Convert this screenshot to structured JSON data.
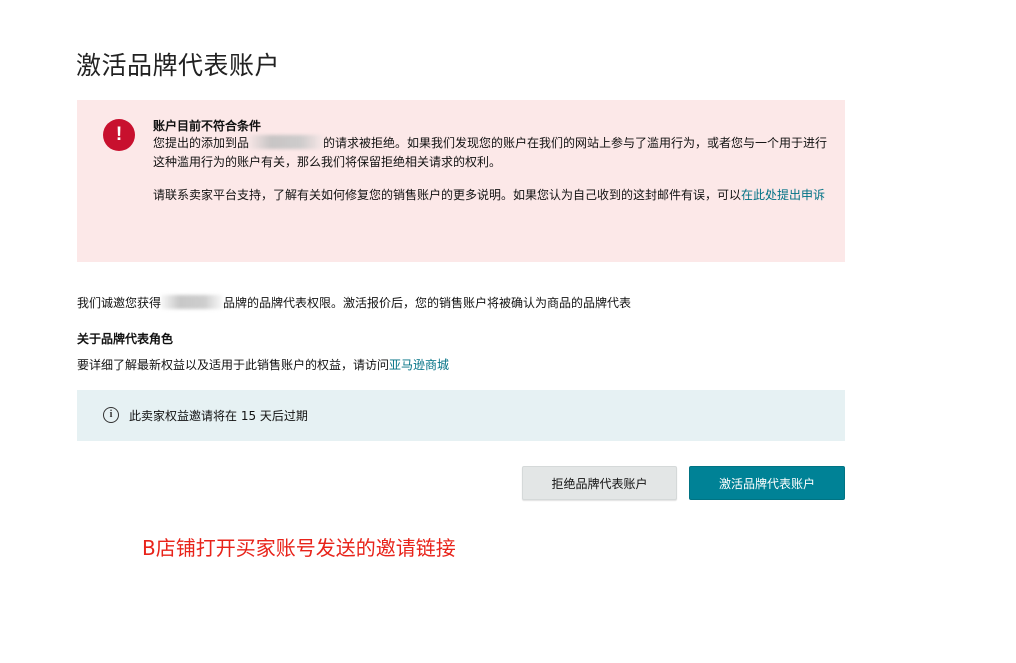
{
  "page": {
    "title": "激活品牌代表账户"
  },
  "error_alert": {
    "icon": "exclamation-icon",
    "title": "账户目前不符合条件",
    "para1_before": "您提出的添加到品",
    "para1_after": "的请求被拒绝。如果我们发现您的账户在我们的网站上参与了滥用行为，或者您与一个用于进行这种滥用行为的账户有关，那么我们将保留拒绝相关请求的权利。",
    "para2_text": "请联系卖家平台支持，了解有关如何修复您的销售账户的更多说明。如果您认为自己收到的这封邮件有误，可以",
    "para2_link": "在此处提出申诉",
    "color": "#fce8e8",
    "icon_color": "#c8102e"
  },
  "invite": {
    "before": "我们诚邀您获得",
    "after": "品牌的品牌代表权限。激活报价后，您的销售账户将被确认为商品的品牌代表"
  },
  "role_section": {
    "heading": "关于品牌代表角色",
    "text": "要详细了解最新权益以及适用于此销售账户的权益，请访问",
    "link": "亚马逊商城"
  },
  "info_alert": {
    "icon": "info-icon",
    "text": "此卖家权益邀请将在 15 天后过期",
    "color": "#e6f1f3"
  },
  "actions": {
    "decline_label": "拒绝品牌代表账户",
    "activate_label": "激活品牌代表账户",
    "activate_color": "#008296"
  },
  "annotation": {
    "text": "B店铺打开买家账号发送的邀请链接",
    "color": "#e8231a"
  }
}
